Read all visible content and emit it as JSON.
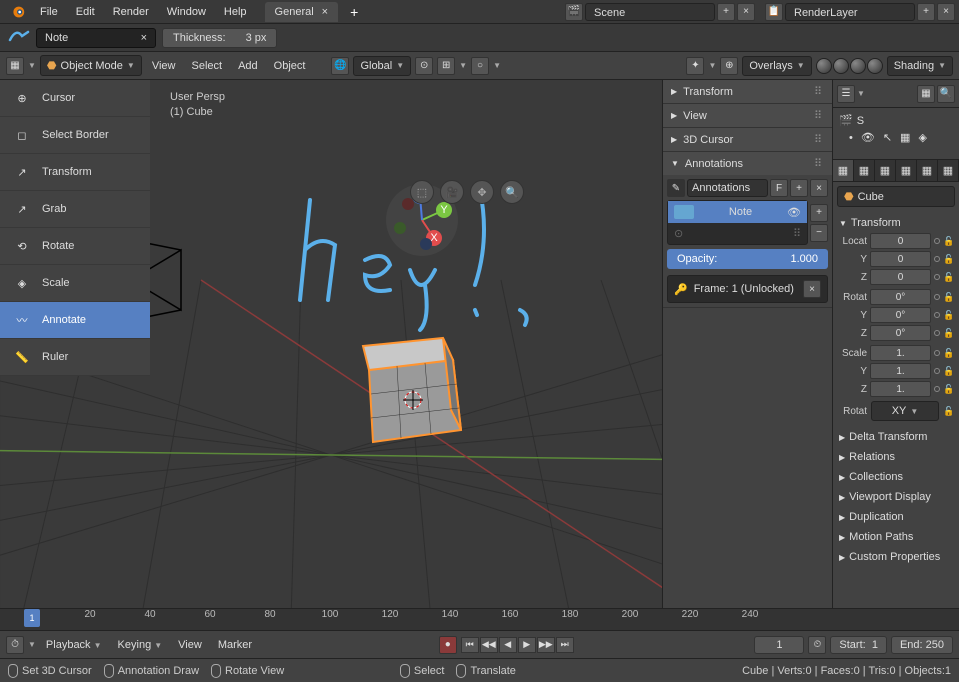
{
  "topMenu": [
    "File",
    "Edit",
    "Render",
    "Window",
    "Help"
  ],
  "workspace": {
    "active": "General"
  },
  "scene": {
    "label": "Scene",
    "renderlayer": "RenderLayer"
  },
  "annotateBar": {
    "note": "Note",
    "thicknessLabel": "Thickness:",
    "thicknessValue": "3 px"
  },
  "header3d": {
    "mode": "Object Mode",
    "menus": [
      "View",
      "Select",
      "Add",
      "Object"
    ],
    "orientation": "Global",
    "overlays": "Overlays",
    "shading": "Shading"
  },
  "toolshelf": {
    "tools": [
      "Cursor",
      "Select Border",
      "Transform",
      "Grab",
      "Rotate",
      "Scale",
      "Annotate",
      "Ruler"
    ],
    "active": "Annotate"
  },
  "viewportInfo": {
    "persp": "User Persp",
    "object": "(1) Cube"
  },
  "annotationText": "Hey!",
  "nPanel": {
    "sections": [
      "Transform",
      "View",
      "3D Cursor",
      "Annotations"
    ],
    "annotations": {
      "label": "Annotations",
      "fake": "F",
      "layerName": "Note",
      "opacityLabel": "Opacity:",
      "opacityValue": "1.000",
      "frame": "Frame: 1 (Unlocked)"
    }
  },
  "properties": {
    "objectName": "Cube",
    "transformLabel": "Transform",
    "loc": {
      "label": "Locat",
      "x": "0",
      "y": "0",
      "z": "0"
    },
    "rot": {
      "label": "Rotat",
      "x": "0°",
      "y": "0°",
      "z": "0°"
    },
    "scale": {
      "label": "Scale",
      "x": "1.",
      "y": "1.",
      "z": "1."
    },
    "rotMode": {
      "label": "Rotat",
      "value": "XY"
    },
    "sections": [
      "Delta Transform",
      "Relations",
      "Collections",
      "Viewport Display",
      "Duplication",
      "Motion Paths",
      "Custom Properties"
    ]
  },
  "outliner": {
    "item": "S"
  },
  "timeline": {
    "ticks": [
      "20",
      "40",
      "60",
      "80",
      "100",
      "120",
      "140",
      "160",
      "180",
      "200",
      "220",
      "240"
    ],
    "current": "1",
    "startLabel": "Start:",
    "startVal": "1",
    "endLabel": "End:",
    "endVal": "250",
    "menus": [
      "Playback",
      "Keying",
      "View",
      "Marker"
    ]
  },
  "statusbar": {
    "items": [
      "Set 3D Cursor",
      "Annotation Draw",
      "Rotate View",
      "Select",
      "Translate"
    ],
    "stats": "Cube | Verts:0 | Faces:0 | Tris:0 | Objects:1"
  }
}
